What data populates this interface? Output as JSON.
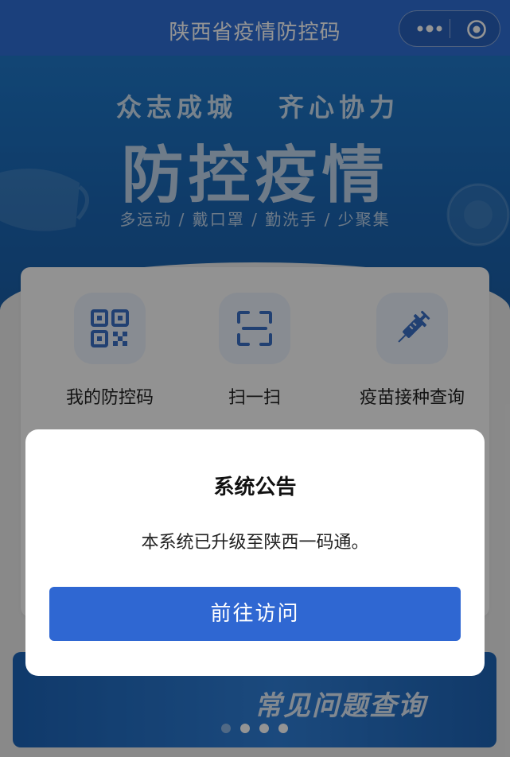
{
  "header": {
    "title": "陕西省疫情防控码",
    "more_icon": "more-dots-icon",
    "close_icon": "target-circle-icon"
  },
  "banner": {
    "slogan_left": "众志成城",
    "slogan_right": "齐心协力",
    "headline": "防控疫情",
    "tips": "多运动 / 戴口罩 / 勤洗手 / 少聚集"
  },
  "functions": [
    {
      "label": "我的防控码",
      "icon": "qr-code-icon"
    },
    {
      "label": "扫一扫",
      "icon": "scan-icon"
    },
    {
      "label": "疫苗接种查询",
      "icon": "syringe-icon"
    }
  ],
  "bottom_banner": {
    "text": "常见问题查询"
  },
  "dialog": {
    "title": "系统公告",
    "message": "本系统已升级至陕西一码通。",
    "button_label": "前往访问"
  },
  "colors": {
    "header": "#2f6fd6",
    "button": "#2f67d2",
    "icon": "#3a6fc4"
  }
}
